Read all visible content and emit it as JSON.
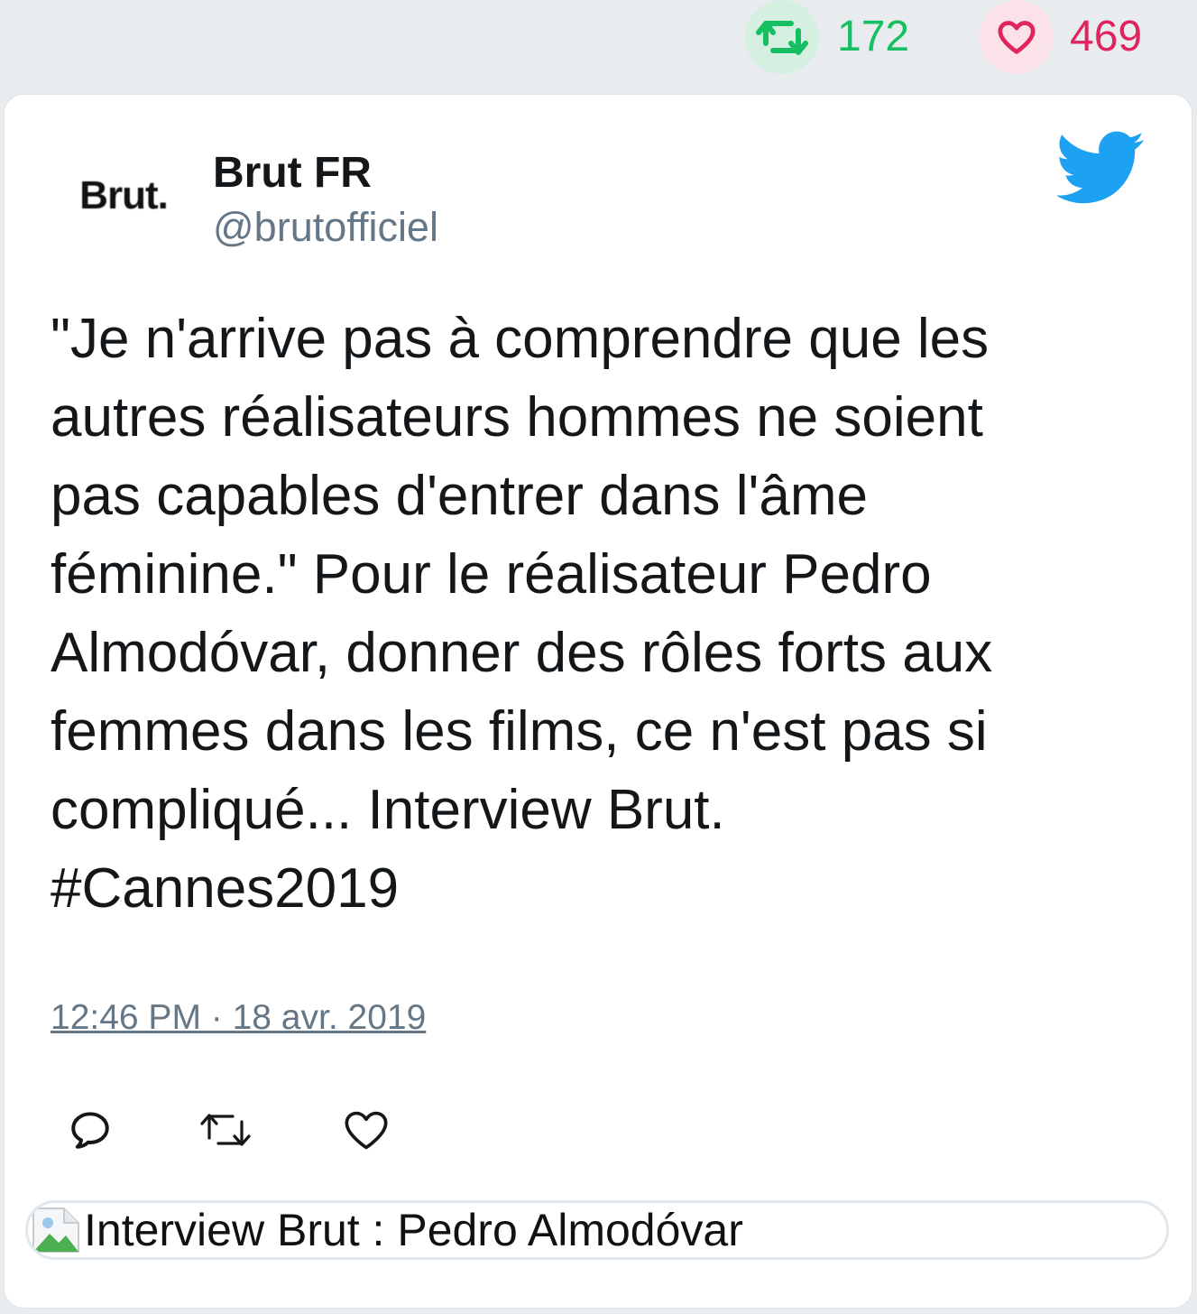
{
  "stats": {
    "retweets": "172",
    "likes": "469",
    "retweet_color": "#17bf63",
    "like_color": "#e0245e"
  },
  "tweet": {
    "avatar_text": "Brut.",
    "name": "Brut FR",
    "handle": "@brutofficiel",
    "text": "\"Je n'arrive pas à comprendre que les\nautres réalisateurs hommes ne soient\npas capables d'entrer dans l'âme\nféminine.\" Pour le réalisateur Pedro\nAlmodóvar, donner des rôles forts aux\nfemmes dans les films, ce n'est pas si\ncompliqué... Interview Brut.\n#Cannes2019",
    "timestamp": "12:46 PM · 18 avr. 2019",
    "brand_color": "#1da1f2"
  },
  "actions": {
    "icons": [
      "reply-icon",
      "retweet-icon",
      "like-icon"
    ]
  },
  "preview": {
    "title": "Interview Brut : Pedro Almodóvar",
    "icon": "broken-image-icon"
  }
}
